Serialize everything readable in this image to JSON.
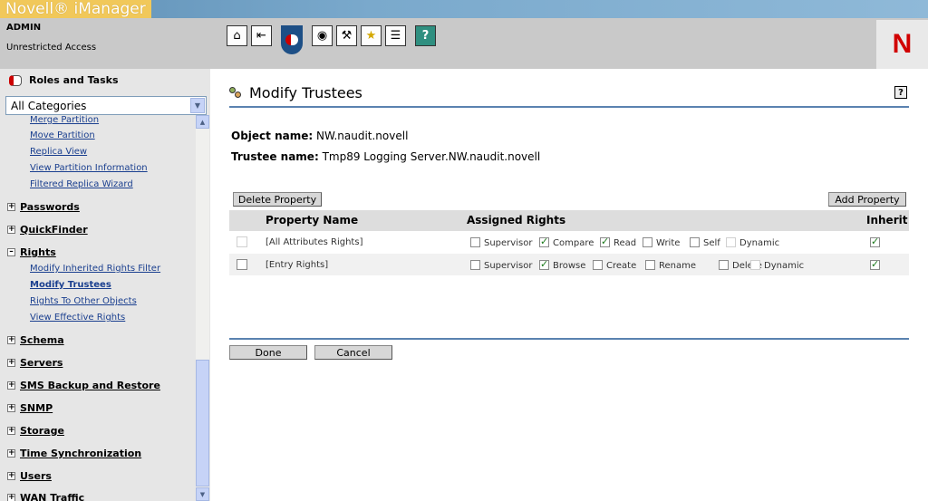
{
  "header": {
    "logo_text": "Novell® iManager",
    "user": "ADMIN",
    "access": "Unrestricted Access",
    "toolbar_icons": [
      "home-icon",
      "exit-icon",
      "roles-tasks-icon",
      "view-objects-icon",
      "configure-icon",
      "favorites-icon",
      "preferences-icon",
      "help-icon"
    ],
    "brand_letter": "N",
    "brand_color": "#d10000"
  },
  "sidebar": {
    "title": "Roles and Tasks",
    "category": "All Categories",
    "partition_links": [
      "Merge Partition",
      "Move Partition",
      "Replica View",
      "View Partition Information",
      "Filtered Replica Wizard"
    ],
    "groups": {
      "passwords": "Passwords",
      "quickfinder": "QuickFinder",
      "rights": "Rights",
      "schema": "Schema",
      "servers": "Servers",
      "sms": "SMS Backup and Restore",
      "snmp": "SNMP",
      "storage": "Storage",
      "timesync": "Time Synchronization",
      "users": "Users",
      "wan": "WAN Traffic"
    },
    "rights_links": [
      "Modify Inherited Rights Filter",
      "Modify Trustees",
      "Rights To Other Objects",
      "View Effective Rights"
    ]
  },
  "main": {
    "title": "Modify Trustees",
    "object_label": "Object name:",
    "object_value": "NW.naudit.novell",
    "trustee_label": "Trustee name:",
    "trustee_value": "Tmp89 Logging Server.NW.naudit.novell",
    "delete_button": "Delete Property",
    "add_button": "Add Property",
    "columns": {
      "property": "Property Name",
      "rights": "Assigned Rights",
      "inherit": "Inherit"
    },
    "rows": [
      {
        "name": "[All Attributes Rights]",
        "selected": false,
        "rights": [
          {
            "label": "Supervisor",
            "checked": false,
            "enabled": true
          },
          {
            "label": "Compare",
            "checked": true,
            "enabled": true
          },
          {
            "label": "Read",
            "checked": true,
            "enabled": true
          },
          {
            "label": "Write",
            "checked": false,
            "enabled": true
          },
          {
            "label": "Self",
            "checked": false,
            "enabled": true
          },
          {
            "label": "Dynamic",
            "checked": false,
            "enabled": false
          }
        ],
        "inherit": true
      },
      {
        "name": "[Entry Rights]",
        "selected": false,
        "rights": [
          {
            "label": "Supervisor",
            "checked": false,
            "enabled": true
          },
          {
            "label": "Browse",
            "checked": true,
            "enabled": true
          },
          {
            "label": "Create",
            "checked": false,
            "enabled": true
          },
          {
            "label": "Rename",
            "checked": false,
            "enabled": true
          },
          {
            "label": "Delete",
            "checked": false,
            "enabled": true
          },
          {
            "label": "Dynamic",
            "checked": false,
            "enabled": false
          }
        ],
        "inherit": true
      }
    ],
    "done_button": "Done",
    "cancel_button": "Cancel"
  }
}
